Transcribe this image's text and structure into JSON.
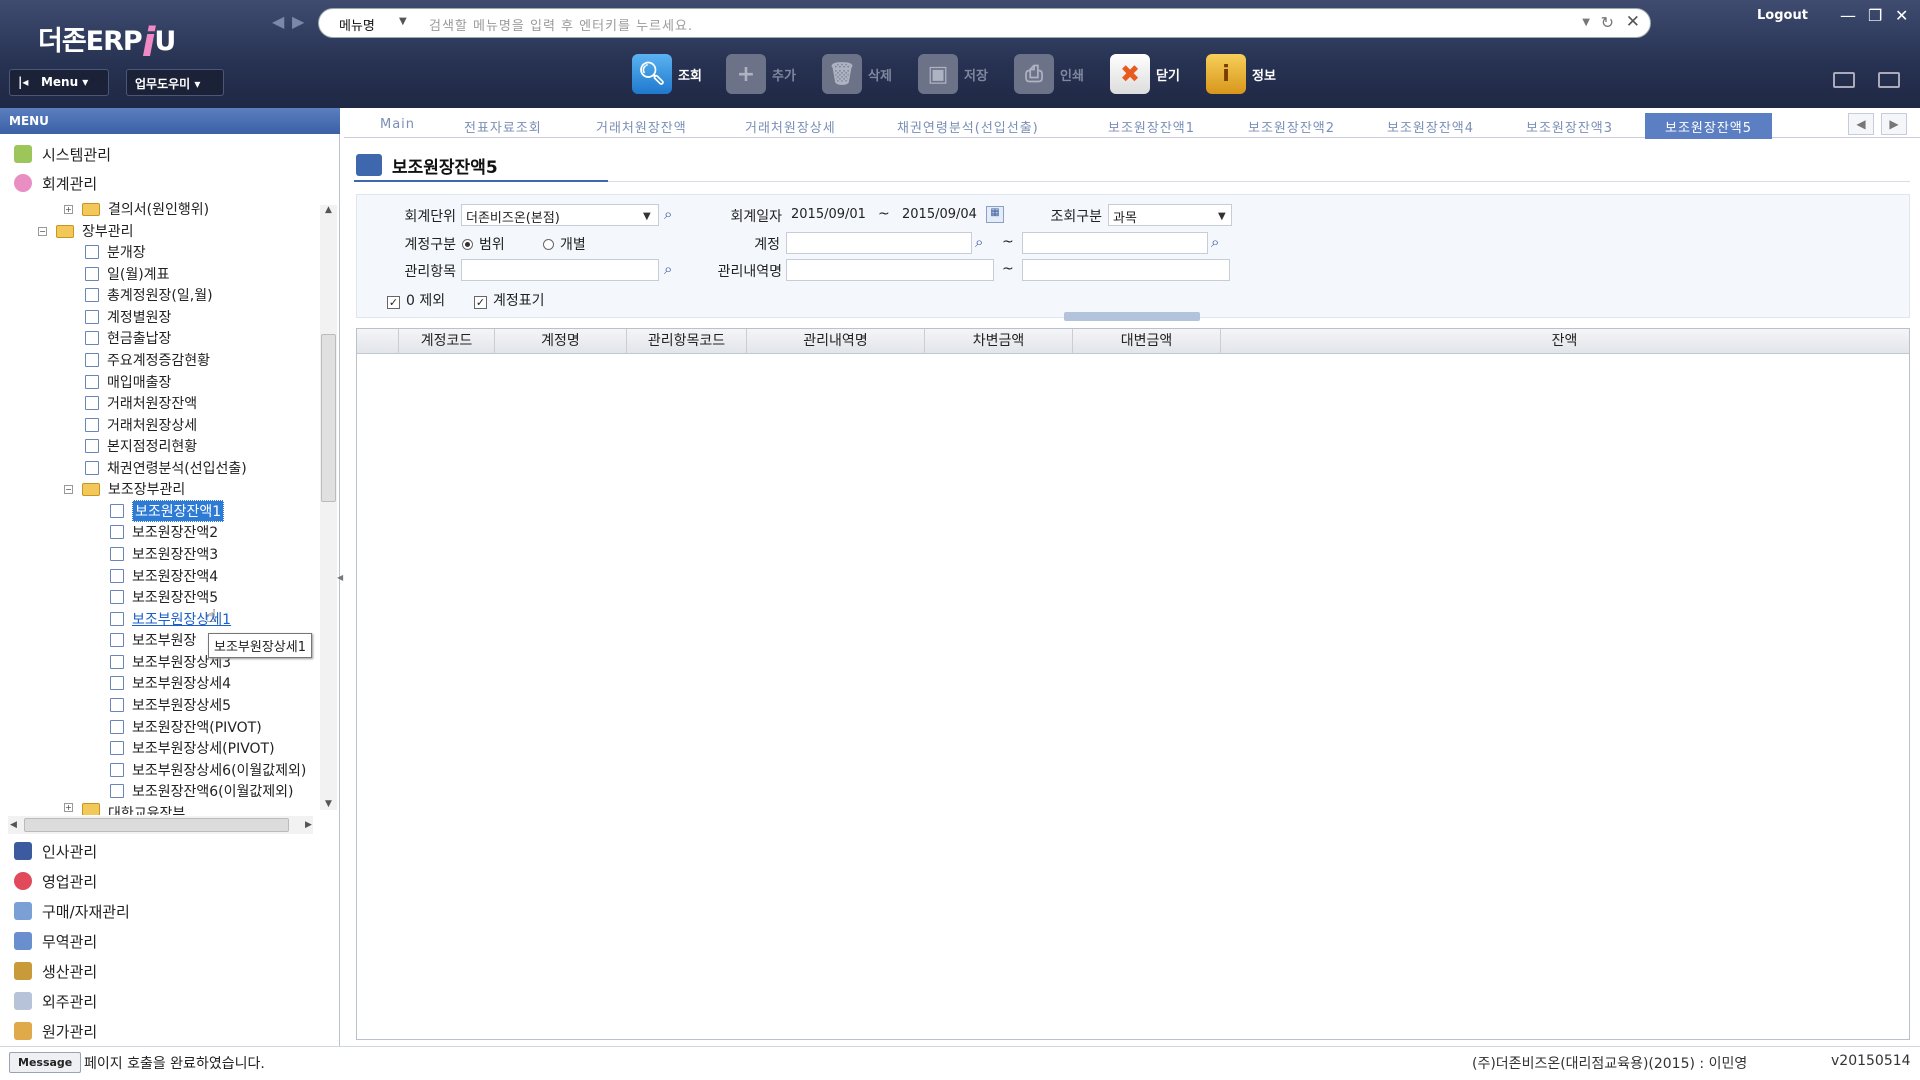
{
  "header": {
    "logo_main": "더존ERP",
    "logo_i": "i",
    "logo_u": "U",
    "search_select": "메뉴명",
    "search_placeholder": "검색할 메뉴명을 입력 후 엔터키를 누르세요.",
    "logout": "Logout",
    "menu_button": "Menu",
    "help_button": "업무도우미",
    "toolbar": [
      {
        "label": "조회",
        "icon": "search-icon",
        "enabled": true,
        "color": "#2f8fe0"
      },
      {
        "label": "추가",
        "icon": "plus-icon",
        "enabled": false
      },
      {
        "label": "삭제",
        "icon": "trash-icon",
        "enabled": false
      },
      {
        "label": "저장",
        "icon": "save-icon",
        "enabled": false
      },
      {
        "label": "인쇄",
        "icon": "print-icon",
        "enabled": false
      },
      {
        "label": "닫기",
        "icon": "close-icon",
        "enabled": true,
        "color": "#e85a1e"
      },
      {
        "label": "정보",
        "icon": "info-icon",
        "enabled": true,
        "color": "#e3a51c"
      }
    ]
  },
  "sidebar": {
    "header": "MENU",
    "top_items": [
      "시스템관리",
      "회계관리"
    ],
    "tree": {
      "n0": "결의서(원인행위)",
      "n1": "장부관리",
      "n2": "분개장",
      "n3": "일(월)계표",
      "n4": "총계정원장(일,월)",
      "n5": "계정별원장",
      "n6": "현금출납장",
      "n7": "주요계정증감현황",
      "n8": "매입매출장",
      "n9": "거래처원장잔액",
      "n10": "거래처원장상세",
      "n11": "본지점정리현황",
      "n12": "채권연령분석(선입선출)",
      "n13": "보조장부관리",
      "n14": "보조원장잔액1",
      "n15": "보조원장잔액2",
      "n16": "보조원장잔액3",
      "n17": "보조원장잔액4",
      "n18": "보조원장잔액5",
      "n19": "보조부원장상세1",
      "n20": "보조부원장",
      "n21": "보조부원장상세3",
      "n22": "보조부원장상세4",
      "n23": "보조부원장상세5",
      "n24": "보조원장잔액(PIVOT)",
      "n25": "보조부원장상세(PIVOT)",
      "n26": "보조부원장상세6(이월값제외)",
      "n27": "보조원장잔액6(이월값제외)",
      "n28": "대한교육장부"
    },
    "tooltip": "보조부원장상세1",
    "bottom_items": [
      "인사관리",
      "영업관리",
      "구매/자재관리",
      "무역관리",
      "생산관리",
      "외주관리",
      "원가관리"
    ]
  },
  "tabs": [
    "Main",
    "전표자료조회",
    "거래처원장잔액",
    "거래처원장상세",
    "채권연령분석(선입선출)",
    "보조원장잔액1",
    "보조원장잔액2",
    "보조원장잔액4",
    "보조원장잔액3",
    "보조원장잔액5"
  ],
  "page": {
    "title": "보조원장잔액5",
    "form": {
      "unit_label": "회계단위",
      "unit_value": "더존비즈온(본점)",
      "date_label": "회계일자",
      "date_from": "2015/09/01",
      "date_to": "2015/09/04",
      "tilde": "~",
      "query_label": "조회구분",
      "query_value": "과목",
      "acct_type_label": "계정구분",
      "radio_range": "범위",
      "radio_individual": "개별",
      "acct_label": "계정",
      "mgmt_item_label": "관리항목",
      "mgmt_detail_label": "관리내역명",
      "chk_zero": "0 제외",
      "chk_acct": "계정표기"
    },
    "grid_columns": [
      "계정코드",
      "계정명",
      "관리항목코드",
      "관리내역명",
      "차변금액",
      "대변금액",
      "잔액"
    ]
  },
  "status": {
    "message_button": "Message",
    "message": "페이지 호출을 완료하였습니다.",
    "company": "(주)더존비즈온(대리점교육용)(2015) : 이민영",
    "version": "v20150514"
  }
}
